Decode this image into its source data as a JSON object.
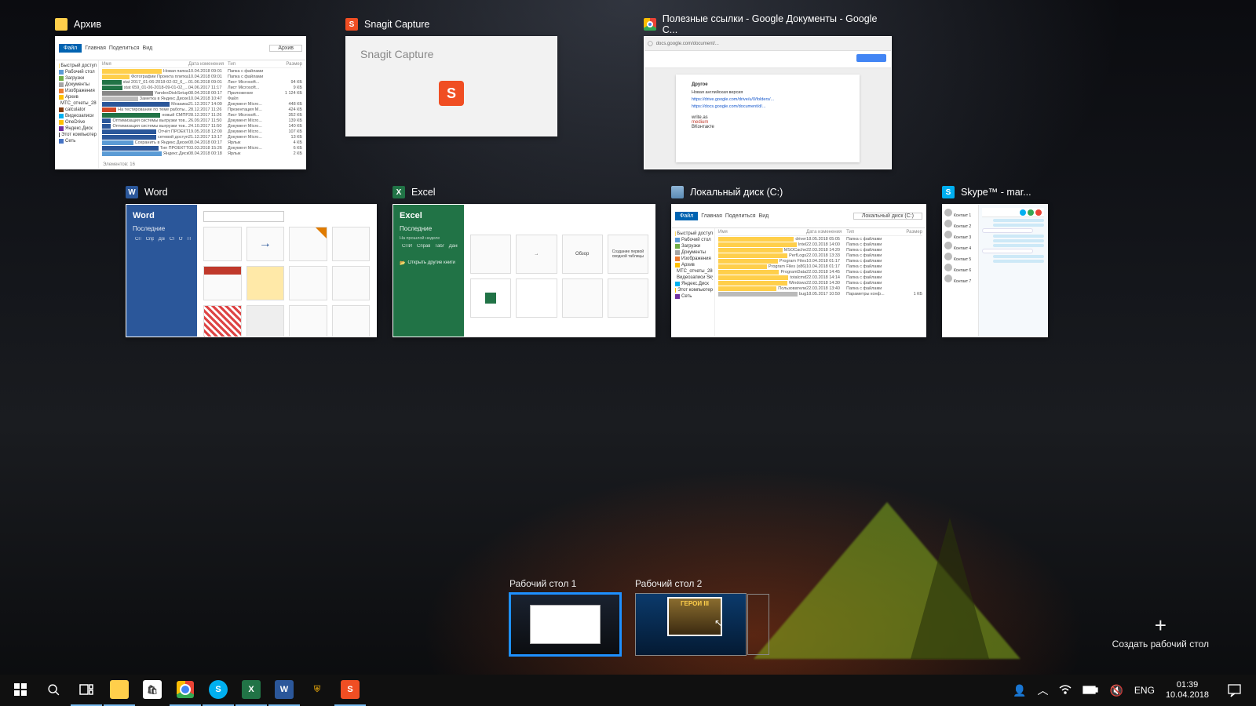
{
  "windows": {
    "archive": {
      "title": "Архив"
    },
    "snagit": {
      "title": "Snagit Capture",
      "heading": "Snagit Capture"
    },
    "chrome": {
      "title": "Полезные ссылки - Google Документы - Google C...",
      "doc": {
        "section": "Другое",
        "line1": "Новая английская версия",
        "link1": "https://drive.google.com/drive/u/0/folders/...",
        "link2": "https://docs.google.com/document/d/...",
        "w1": "write.as",
        "w2": "medium",
        "w3": "ВКонтакте"
      }
    },
    "word": {
      "title": "Word",
      "heading": "Word",
      "recent": "Последние",
      "files": [
        "СПИСОК",
        "Справочник",
        "Документ",
        "Статья",
        "Отчёт",
        "План"
      ]
    },
    "excel": {
      "title": "Excel",
      "heading": "Excel",
      "recent": "Последние",
      "sideline": "На прошлой неделе",
      "files": [
        "СПИСОК",
        "Справочник",
        "Таблица",
        "Данные"
      ],
      "openother": "Открыть другие книги",
      "tpl_overview": "Обзор",
      "tpl_pivot": "Создание первой сводной таблицы"
    },
    "localdisk": {
      "title": "Локальный диск (C:)",
      "cols": [
        "Имя",
        "Дата изменения",
        "Тип",
        "Размер"
      ],
      "items": [
        {
          "n": "driver",
          "d": "18.05.2018 05:05",
          "t": "Папка с файлами",
          "s": ""
        },
        {
          "n": "Intel",
          "d": "22.03.2018 14:00",
          "t": "Папка с файлами",
          "s": ""
        },
        {
          "n": "MSOCache",
          "d": "22.03.2018 14:20",
          "t": "Папка с файлами",
          "s": ""
        },
        {
          "n": "PerfLogs",
          "d": "22.03.2018 13:33",
          "t": "Папка с файлами",
          "s": ""
        },
        {
          "n": "Program Files",
          "d": "10.04.2018 01:17",
          "t": "Папка с файлами",
          "s": ""
        },
        {
          "n": "Program Files (x86)",
          "d": "10.04.2018 01:17",
          "t": "Папка с файлами",
          "s": ""
        },
        {
          "n": "ProgramData",
          "d": "22.03.2018 14:45",
          "t": "Папка с файлами",
          "s": ""
        },
        {
          "n": "totalcmd",
          "d": "22.03.2018 14:14",
          "t": "Папка с файлами",
          "s": ""
        },
        {
          "n": "Windows",
          "d": "22.03.2018 14:30",
          "t": "Папка с файлами",
          "s": ""
        },
        {
          "n": "Пользователи",
          "d": "22.03.2018 13:40",
          "t": "Папка с файлами",
          "s": ""
        },
        {
          "n": "bug",
          "d": "18.05.2017 10:50",
          "t": "Параметры конф...",
          "s": "1 КБ"
        }
      ],
      "side": [
        "Быстрый доступ",
        "Рабочий стол",
        "Загрузки",
        "Документы",
        "Изображения",
        "Архив",
        "MTC_отчеты_280",
        "Видеозаписи Skype",
        "Яндекс.Диск",
        "Этот компьютер",
        "Сеть"
      ]
    },
    "archive_explorer": {
      "path": "Архив",
      "menus": [
        "Главная",
        "Поделиться",
        "Вид"
      ],
      "cols": [
        "Имя",
        "Дата изменения",
        "Тип",
        "Размер"
      ],
      "side": [
        "Быстрый доступ",
        "Рабочий стол",
        "Загрузки",
        "Документы",
        "Изображения",
        "Архив",
        "MTC_отчеты_280",
        "calculator",
        "Видеозаписи",
        "OneDrive",
        "Яндекс.Диск",
        "Этот компьютер",
        "Сеть"
      ],
      "items": [
        {
          "n": "Новая папка",
          "d": "10.04.2018 09:01",
          "t": "Папка с файлами",
          "s": ""
        },
        {
          "n": "Фотографии Проекта плитка",
          "d": "10.04.2018 09:01",
          "t": "Папка с файлами",
          "s": ""
        },
        {
          "n": "stat 2017_01-06-2018-02-02_6_...",
          "d": "01.06.2018 09:01",
          "t": "Лист Microsoft...",
          "s": "94 КБ"
        },
        {
          "n": "stat 659_01-06-2018-09-01-02_...",
          "d": "04.06.2017 11:17",
          "t": "Лист Microsoft...",
          "s": "9 КБ"
        },
        {
          "n": "YandexDiskSetup",
          "d": "08.04.2018 00:17",
          "t": "Приложение",
          "s": "1 124 КБ"
        },
        {
          "n": "Заметка в Яндекс Диске",
          "d": "10.04.2018 10:47",
          "t": "Файл",
          "s": ""
        },
        {
          "n": "Мозаика",
          "d": "21.12.2017 14:09",
          "t": "Документ Micro...",
          "s": "448 КБ"
        },
        {
          "n": "На тестирование по теме работы...",
          "d": "28.12.2017 11:26",
          "t": "Презентация M...",
          "s": "424 КБ"
        },
        {
          "n": "новый СМПР",
          "d": "28.12.2017 11:26",
          "t": "Лист Microsoft...",
          "s": "352 КБ"
        },
        {
          "n": "Оптимизация системы выгрузки тов...",
          "d": "26.09.2017 11:50",
          "t": "Документ Micro...",
          "s": "139 КБ"
        },
        {
          "n": "Оптимизация системы выгрузки тов...",
          "d": "24.10.2017 11:50",
          "t": "Документ Micro...",
          "s": "140 КБ"
        },
        {
          "n": "Отчёт ПРОЕКТ",
          "d": "19.05.2018 12:00",
          "t": "Документ Micro...",
          "s": "107 КБ"
        },
        {
          "n": "сетевой доступ",
          "d": "21.12.2017 13:17",
          "t": "Документ Micro...",
          "s": "13 КБ"
        },
        {
          "n": "Сохранить в Яндекс Диске",
          "d": "08.04.2018 00:17",
          "t": "Ярлык",
          "s": "4 КБ"
        },
        {
          "n": "Тип ПРОЕКТТ",
          "d": "03.03.2018 15:26",
          "t": "Документ Micro...",
          "s": "6 КБ"
        },
        {
          "n": "Яндекс.Диск",
          "d": "08.04.2018 00:18",
          "t": "Ярлык",
          "s": "2 КБ"
        }
      ],
      "status": "Элементов: 16"
    },
    "skype": {
      "title": "Skype™ - mar...",
      "contacts": [
        "Контакт 1",
        "Контакт 2",
        "Контакт 3",
        "Контакт 4",
        "Контакт 5",
        "Контакт 6",
        "Контакт 7"
      ]
    }
  },
  "virtual_desktops": {
    "d1": "Рабочий стол 1",
    "d2": "Рабочий стол 2",
    "game_title": "ГЕРОИ III",
    "new": "Создать рабочий стол"
  },
  "taskbar": {
    "lang": "ENG",
    "time": "01:39",
    "date": "10.04.2018"
  }
}
